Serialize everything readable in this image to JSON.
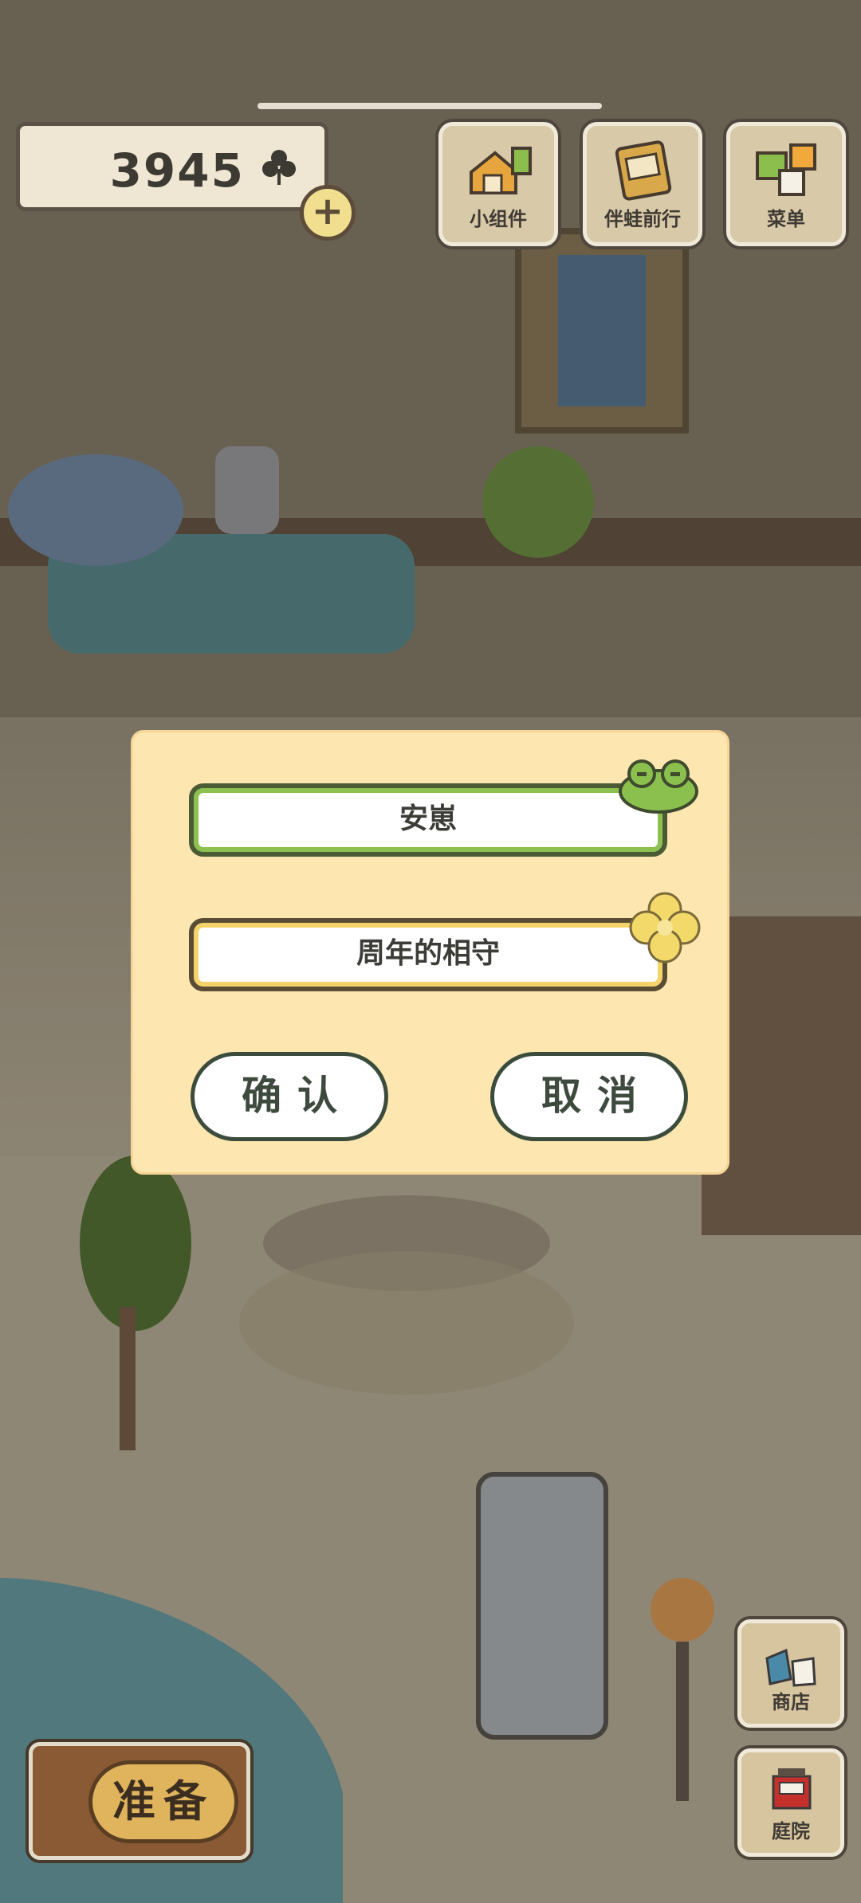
{
  "top": {
    "clover_count": "3945",
    "plus_label": "+",
    "buttons": [
      {
        "label": "小组件",
        "icon": "widget-icon"
      },
      {
        "label": "伴蛙前行",
        "icon": "travel-journal-icon"
      },
      {
        "label": "菜单",
        "icon": "menu-icon"
      }
    ]
  },
  "dialog": {
    "field_frog": "安崽",
    "field_clover": "周年的相守",
    "confirm_label": "确认",
    "cancel_label": "取消"
  },
  "bottom": {
    "ready_label": "准备",
    "shop_label": "商店",
    "garden_label": "庭院"
  },
  "colors": {
    "dialog_bg": "#fde6b0",
    "field_green_border": "#8cc04f",
    "field_yellow_border": "#f3d36a",
    "button_bg": "#ffffff"
  }
}
